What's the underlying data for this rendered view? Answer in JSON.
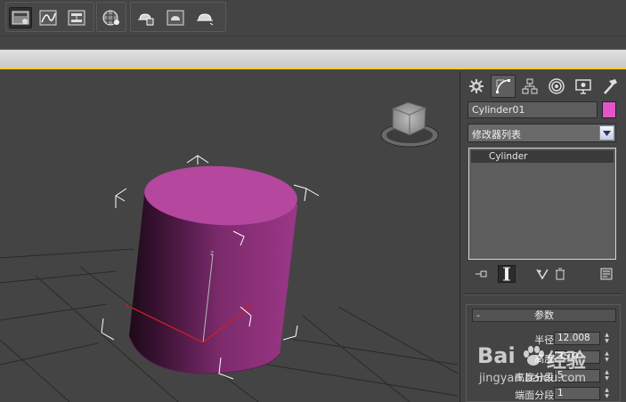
{
  "object": {
    "name": "Cylinder01",
    "color": "#e255c8"
  },
  "modifier": {
    "list_label": "修改器列表",
    "stack_items": [
      "Cylinder"
    ]
  },
  "parameters": {
    "title": "参数",
    "collapse_symbol": "-",
    "fields": [
      {
        "label": "半径:",
        "value": "12.008"
      },
      {
        "label": "高度:",
        "value": "35.0"
      },
      {
        "label": "高度分段:",
        "value": "5"
      },
      {
        "label": "端面分段:",
        "value": "1"
      }
    ]
  },
  "toolbar": {
    "buttons": [
      "scene-explorer-icon",
      "curve-editor-icon",
      "schematic-view-icon",
      "material-editor-icon",
      "render-setup-icon",
      "rendered-frame-icon",
      "render-icon"
    ]
  },
  "panel_tabs": [
    "create-icon",
    "modify-icon",
    "hierarchy-icon",
    "motion-icon",
    "display-icon",
    "utilities-icon"
  ],
  "watermark": {
    "brand": "Bai",
    "brand2": "经验",
    "url": "jingyan.baidu.com"
  },
  "colors": {
    "accent_strip": "#ffcc33",
    "cylinder_top": "#b5479e",
    "cylinder_side": "#8a2f78",
    "background": "#444444"
  }
}
